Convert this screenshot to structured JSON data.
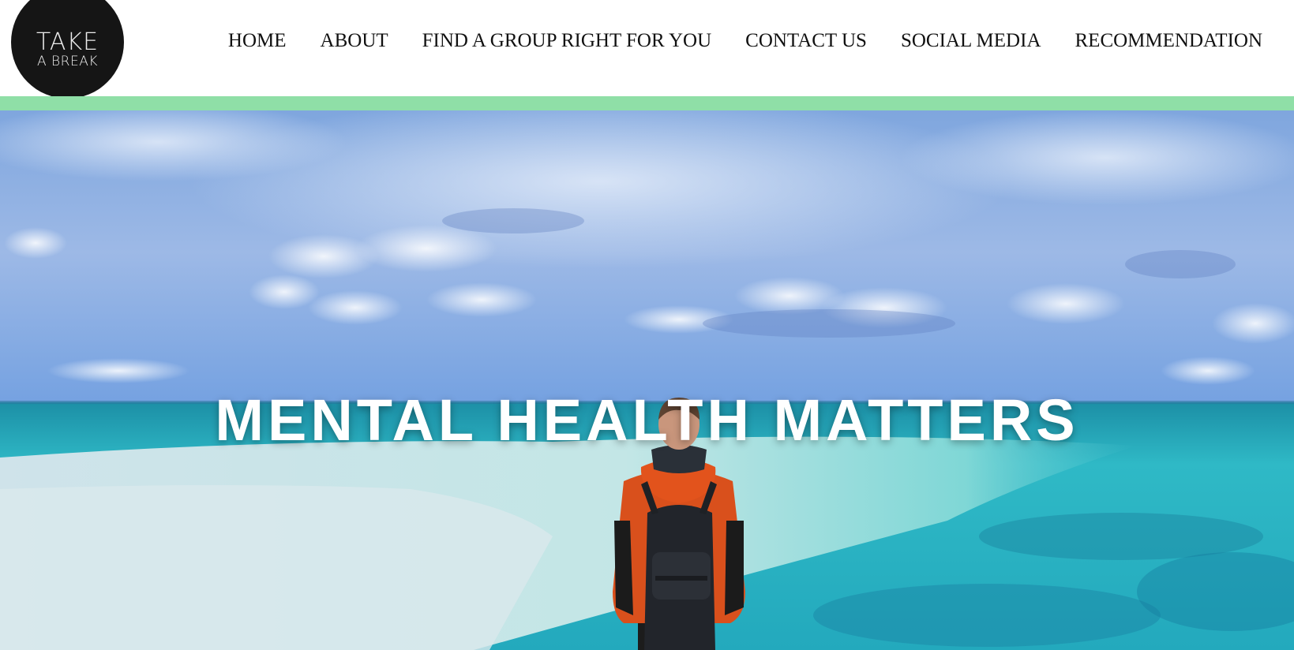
{
  "logo": {
    "line1": "TAKE",
    "line2": "A BREAK",
    "background": "#151515"
  },
  "nav": {
    "items": [
      {
        "label": "HOME"
      },
      {
        "label": "ABOUT"
      },
      {
        "label": "FIND A GROUP RIGHT FOR YOU"
      },
      {
        "label": "CONTACT US"
      },
      {
        "label": "SOCIAL MEDIA"
      },
      {
        "label": "RECOMMENDATION"
      }
    ]
  },
  "accent_color": "#8fdfa7",
  "hero": {
    "title": "MENTAL HEALTH MATTERS",
    "image_subject": "person with orange jacket and backpack facing turquoise sea under cloudy blue sky"
  }
}
